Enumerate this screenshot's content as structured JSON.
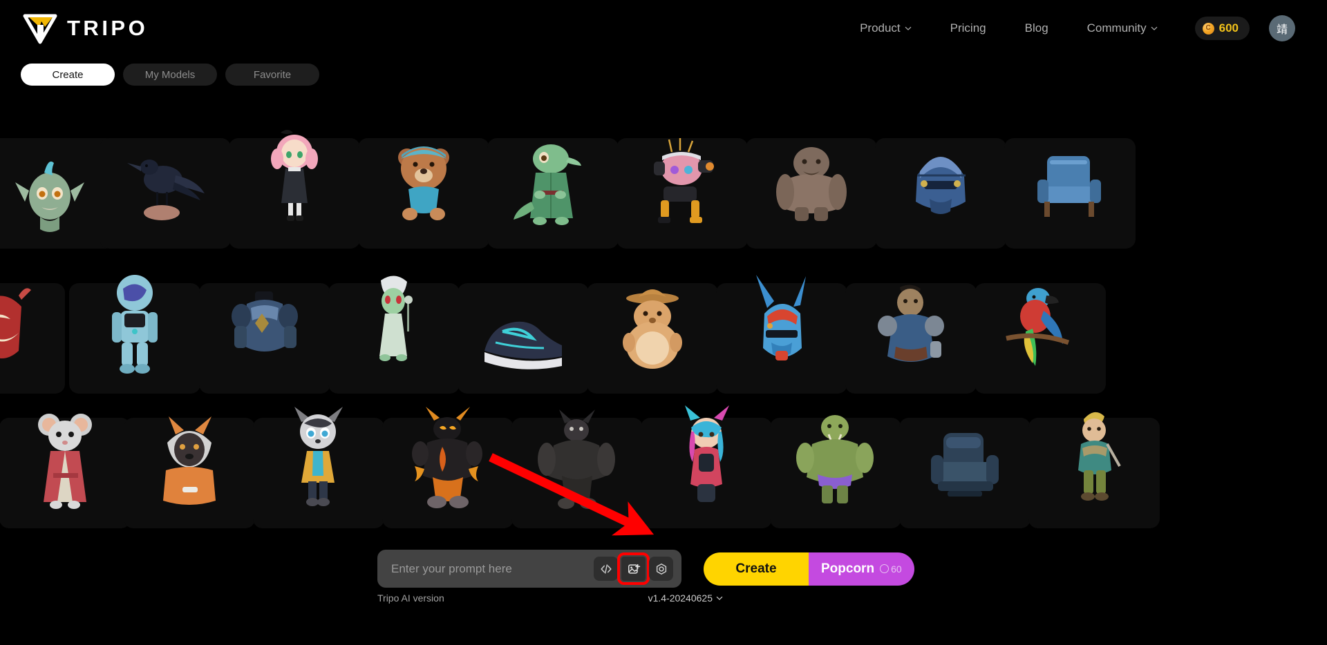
{
  "header": {
    "logo_text": "TRIPO",
    "logo_icon": "tripo-logo-icon",
    "nav": [
      {
        "label": "Product",
        "has_caret": true
      },
      {
        "label": "Pricing",
        "has_caret": false
      },
      {
        "label": "Blog",
        "has_caret": false
      },
      {
        "label": "Community",
        "has_caret": true
      }
    ],
    "credits": {
      "icon": "coin-icon",
      "amount": "600",
      "color": "#f2c21a"
    },
    "avatar": {
      "initial": "靖",
      "bg": "#5a6a75"
    }
  },
  "tabs": [
    {
      "label": "Create",
      "active": true
    },
    {
      "label": "My Models",
      "active": false
    },
    {
      "label": "Favorite",
      "active": false
    }
  ],
  "gallery": {
    "rows": [
      {
        "row_index": 1,
        "cards": [
          {
            "name": "goblin-head",
            "label": "goblin head bust"
          },
          {
            "name": "crow-on-rock",
            "label": "crow perched on rock"
          },
          {
            "name": "pink-hair-doll",
            "label": "pink hair anime doll"
          },
          {
            "name": "teddy-bear-beanie",
            "label": "teddy bear with blue beanie"
          },
          {
            "name": "lizard-monk",
            "label": "green lizard in robe"
          },
          {
            "name": "pink-mech-robot",
            "label": "pink quadruped mech robot"
          },
          {
            "name": "stone-troll",
            "label": "stone troll creature"
          },
          {
            "name": "blue-helmet",
            "label": "ornate blue helmet"
          },
          {
            "name": "blue-armchair",
            "label": "blue upholstered armchair"
          }
        ]
      },
      {
        "row_index": 2,
        "cards": [
          {
            "name": "oni-mask",
            "label": "red oni demon mask"
          },
          {
            "name": "astronaut-suit",
            "label": "light blue astronaut suit"
          },
          {
            "name": "knight-armor",
            "label": "steel knight chest armor"
          },
          {
            "name": "alien-mage",
            "label": "green alien mage with staff"
          },
          {
            "name": "running-shoe",
            "label": "navy running sneaker"
          },
          {
            "name": "hamster-cowboy",
            "label": "hamster in cowboy hat"
          },
          {
            "name": "blue-mech-helm",
            "label": "blue mecha helmet"
          },
          {
            "name": "orc-warrior",
            "label": "orc warrior in armor"
          },
          {
            "name": "macaw-parrot",
            "label": "macaw parrot on branch"
          }
        ]
      },
      {
        "row_index": 3,
        "cards": [
          {
            "name": "mouse-kimono",
            "label": "mouse in red kimono"
          },
          {
            "name": "fox-hoodie",
            "label": "animal in orange hoodie"
          },
          {
            "name": "raccoon-kid",
            "label": "raccoon child in jacket"
          },
          {
            "name": "lava-demon",
            "label": "lava demon beast"
          },
          {
            "name": "werewolf",
            "label": "dark werewolf creature"
          },
          {
            "name": "catgirl-cyber",
            "label": "cyberpunk cat-ear girl"
          },
          {
            "name": "green-orc-brute",
            "label": "green orc brute"
          },
          {
            "name": "leather-recliner",
            "label": "blue leather recliner"
          },
          {
            "name": "elf-adventurer",
            "label": "elf adventurer"
          }
        ]
      }
    ]
  },
  "prompt": {
    "placeholder": "Enter your prompt here",
    "value": "",
    "icons": [
      {
        "name": "code-brackets-icon",
        "glyph": "</>",
        "highlighted": false
      },
      {
        "name": "image-upload-icon",
        "glyph": "image-plus",
        "highlighted": true
      },
      {
        "name": "hexagon-target-icon",
        "glyph": "hexagon",
        "highlighted": false
      }
    ],
    "create_label": "Create",
    "popcorn_label": "Popcorn",
    "popcorn_cost": "60"
  },
  "version": {
    "label": "Tripo AI version",
    "value": "v1.4-20240625"
  },
  "colors": {
    "background": "#000000",
    "card": "#0d0d0d",
    "create_yellow": "#FFD400",
    "popcorn_purple": "#c44ae0",
    "annotation_red": "#ff0000",
    "credits_yellow": "#f2c21a"
  }
}
